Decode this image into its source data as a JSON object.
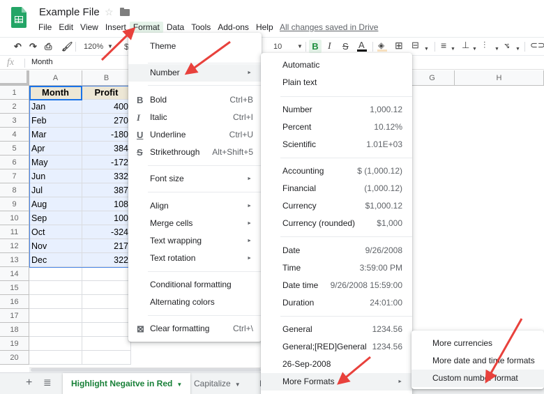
{
  "app": {
    "title": "Example File",
    "saved_status": "All changes saved in Drive",
    "menus": [
      "File",
      "Edit",
      "View",
      "Insert",
      "Format",
      "Data",
      "Tools",
      "Add-ons",
      "Help"
    ],
    "active_menu": "Format"
  },
  "toolbar": {
    "zoom": "120%",
    "currency_glyph": "$",
    "font_size": "10",
    "bold": "B",
    "italic": "I",
    "strike": "S",
    "text_color": "A"
  },
  "formula_bar": {
    "fx": "fx",
    "value": "Month"
  },
  "sheet": {
    "columns": [
      "A",
      "B",
      "G",
      "H"
    ],
    "rows": [
      "1",
      "2",
      "3",
      "4",
      "5",
      "6",
      "7",
      "8",
      "9",
      "10",
      "11",
      "12",
      "13",
      "14",
      "15",
      "16",
      "17",
      "18",
      "19",
      "20"
    ],
    "header": [
      "Month",
      "Profit"
    ],
    "data": [
      [
        "Jan",
        "400"
      ],
      [
        "Feb",
        "270"
      ],
      [
        "Mar",
        "-180"
      ],
      [
        "Apr",
        "384"
      ],
      [
        "May",
        "-172"
      ],
      [
        "Jun",
        "332"
      ],
      [
        "Jul",
        "387"
      ],
      [
        "Aug",
        "108"
      ],
      [
        "Sep",
        "100"
      ],
      [
        "Oct",
        "-324"
      ],
      [
        "Nov",
        "217"
      ],
      [
        "Dec",
        "322"
      ]
    ],
    "tabs": [
      {
        "label": "Highlight Negaitve in Red",
        "active": true
      },
      {
        "label": "Capitalize",
        "active": false
      },
      {
        "label": "F",
        "active": false
      }
    ]
  },
  "format_menu": {
    "items": [
      {
        "label": "Theme"
      },
      {
        "label": "Number",
        "submenu": true,
        "highlighted": true
      },
      {
        "label": "Bold",
        "shortcut": "Ctrl+B",
        "icon": "bold-icon"
      },
      {
        "label": "Italic",
        "shortcut": "Ctrl+I",
        "icon": "italic-icon"
      },
      {
        "label": "Underline",
        "shortcut": "Ctrl+U",
        "icon": "underline-icon"
      },
      {
        "label": "Strikethrough",
        "shortcut": "Alt+Shift+5",
        "icon": "strikethrough-icon"
      },
      {
        "label": "Font size",
        "submenu": true
      },
      {
        "label": "Align",
        "submenu": true
      },
      {
        "label": "Merge cells",
        "submenu": true
      },
      {
        "label": "Text wrapping",
        "submenu": true
      },
      {
        "label": "Text rotation",
        "submenu": true
      },
      {
        "label": "Conditional formatting"
      },
      {
        "label": "Alternating colors"
      },
      {
        "label": "Clear formatting",
        "shortcut": "Ctrl+\\",
        "icon": "clear-formatting-icon"
      }
    ]
  },
  "number_menu": {
    "items": [
      {
        "label": "Automatic",
        "sample": ""
      },
      {
        "label": "Plain text",
        "sample": ""
      },
      {
        "label": "Number",
        "sample": "1,000.12"
      },
      {
        "label": "Percent",
        "sample": "10.12%"
      },
      {
        "label": "Scientific",
        "sample": "1.01E+03"
      },
      {
        "label": "Accounting",
        "sample": "$ (1,000.12)"
      },
      {
        "label": "Financial",
        "sample": "(1,000.12)"
      },
      {
        "label": "Currency",
        "sample": "$1,000.12"
      },
      {
        "label": "Currency (rounded)",
        "sample": "$1,000"
      },
      {
        "label": "Date",
        "sample": "9/26/2008"
      },
      {
        "label": "Time",
        "sample": "3:59:00 PM"
      },
      {
        "label": "Date time",
        "sample": "9/26/2008 15:59:00"
      },
      {
        "label": "Duration",
        "sample": "24:01:00"
      },
      {
        "label": "General",
        "sample": "1234.56"
      },
      {
        "label": "General;[RED]General",
        "sample": "1234.56"
      },
      {
        "label": "26-Sep-2008",
        "sample": ""
      },
      {
        "label": "More Formats",
        "sample": "",
        "submenu": true,
        "highlighted": true
      }
    ]
  },
  "more_formats_menu": {
    "items": [
      {
        "label": "More currencies"
      },
      {
        "label": "More date and time formats"
      },
      {
        "label": "Custom number format",
        "highlighted": true
      }
    ]
  },
  "colors": {
    "accent_green": "#188038",
    "selection_blue": "#1a73e8",
    "annotation_red": "#e8413c"
  }
}
